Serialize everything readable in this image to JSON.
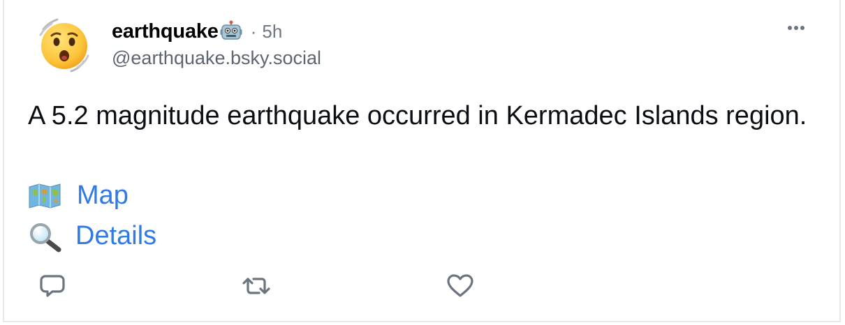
{
  "post": {
    "author": {
      "display_name": "earthquake",
      "badge_icon": "robot-icon",
      "separator": "·",
      "age": "5h",
      "handle": "@earthquake.bsky.social",
      "avatar_icon": "astonished-face-icon"
    },
    "text": "A 5.2 magnitude earthquake occurred in Kermadec Islands region.",
    "links": [
      {
        "emoji": "world-map-icon",
        "label": "Map"
      },
      {
        "emoji": "magnifying-glass-icon",
        "label": "Details"
      }
    ],
    "actions": {
      "reply_icon": "reply-icon",
      "repost_icon": "repost-icon",
      "like_icon": "heart-icon",
      "more_icon": "more-options-icon"
    }
  },
  "colors": {
    "link": "#2f7ae5",
    "muted_text": "#6f7782",
    "action_icon": "#6b7480",
    "border": "#e6e8eb"
  }
}
